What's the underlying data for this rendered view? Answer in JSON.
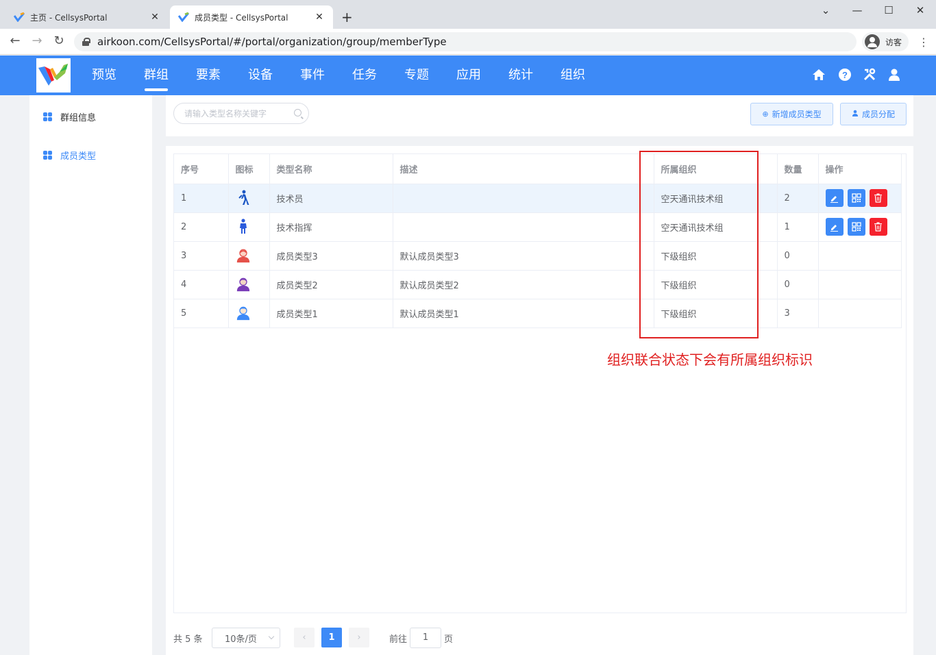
{
  "browser": {
    "tabs": [
      {
        "title": "主页 - CellsysPortal",
        "close": "✕"
      },
      {
        "title": "成员类型 - CellsysPortal",
        "close": "✕"
      }
    ],
    "new_tab": "+",
    "url": "airkoon.com/CellsysPortal/#/portal/organization/group/memberType",
    "profile_label": "访客"
  },
  "header": {
    "nav": [
      "预览",
      "群组",
      "要素",
      "设备",
      "事件",
      "任务",
      "专题",
      "应用",
      "统计",
      "组织"
    ],
    "active_index": 1,
    "icons": [
      "home-icon",
      "help-icon",
      "tools-icon",
      "user-icon"
    ]
  },
  "sidebar": {
    "items": [
      {
        "label": "群组信息",
        "active": false
      },
      {
        "label": "成员类型",
        "active": true
      }
    ]
  },
  "toolbar": {
    "search_placeholder": "请输入类型名称关键字",
    "add_label": "新增成员类型",
    "assign_label": "成员分配"
  },
  "table": {
    "columns": [
      "序号",
      "图标",
      "类型名称",
      "描述",
      "所属组织",
      "数量",
      "操作"
    ],
    "rows": [
      {
        "index": "1",
        "icon": "walking-person-icon",
        "name": "技术员",
        "desc": "",
        "org": "空天通讯技术组",
        "count": "2",
        "ops": true
      },
      {
        "index": "2",
        "icon": "standing-person-icon",
        "name": "技术指挥",
        "desc": "",
        "org": "空天通讯技术组",
        "count": "1",
        "ops": true
      },
      {
        "index": "3",
        "icon": "avatar-red-icon",
        "name": "成员类型3",
        "desc": "默认成员类型3",
        "org": "下级组织",
        "count": "0",
        "ops": false
      },
      {
        "index": "4",
        "icon": "avatar-purple-icon",
        "name": "成员类型2",
        "desc": "默认成员类型2",
        "org": "下级组织",
        "count": "0",
        "ops": false
      },
      {
        "index": "5",
        "icon": "avatar-blue-icon",
        "name": "成员类型1",
        "desc": "默认成员类型1",
        "org": "下级组织",
        "count": "3",
        "ops": false
      }
    ]
  },
  "annotation": "组织联合状态下会有所属组织标识",
  "pagination": {
    "total_label": "共 5 条",
    "page_size": "10条/页",
    "current_page": "1",
    "goto_prefix": "前往",
    "goto_value": "1",
    "goto_suffix": "页"
  },
  "colors": {
    "primary": "#3d8af7",
    "danger": "#f5222d",
    "annotation": "#e02020"
  }
}
